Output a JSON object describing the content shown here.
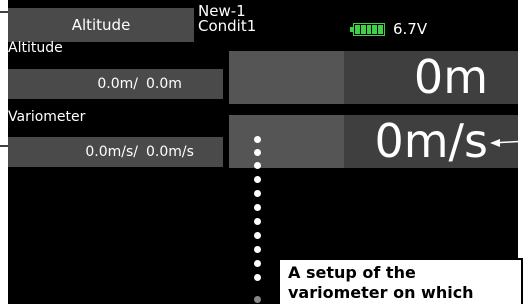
{
  "header": {
    "screen_title": "Altitude",
    "model_name": "New-1",
    "condition": "Condit1",
    "battery_voltage": "6.7V",
    "battery_icon": "battery-icon",
    "battery_color": "#3fd04a"
  },
  "altitude": {
    "label": "Altitude",
    "value_1": "0.0m/",
    "value_2": "0.0m",
    "big_value": "0m"
  },
  "variometer": {
    "label": "Variometer",
    "value_1": "0.0m/s/",
    "value_2": "0.0m/s",
    "big_value": "0m/s"
  },
  "callout": {
    "line1": "A setup of the",
    "line2": "variometer on which"
  }
}
